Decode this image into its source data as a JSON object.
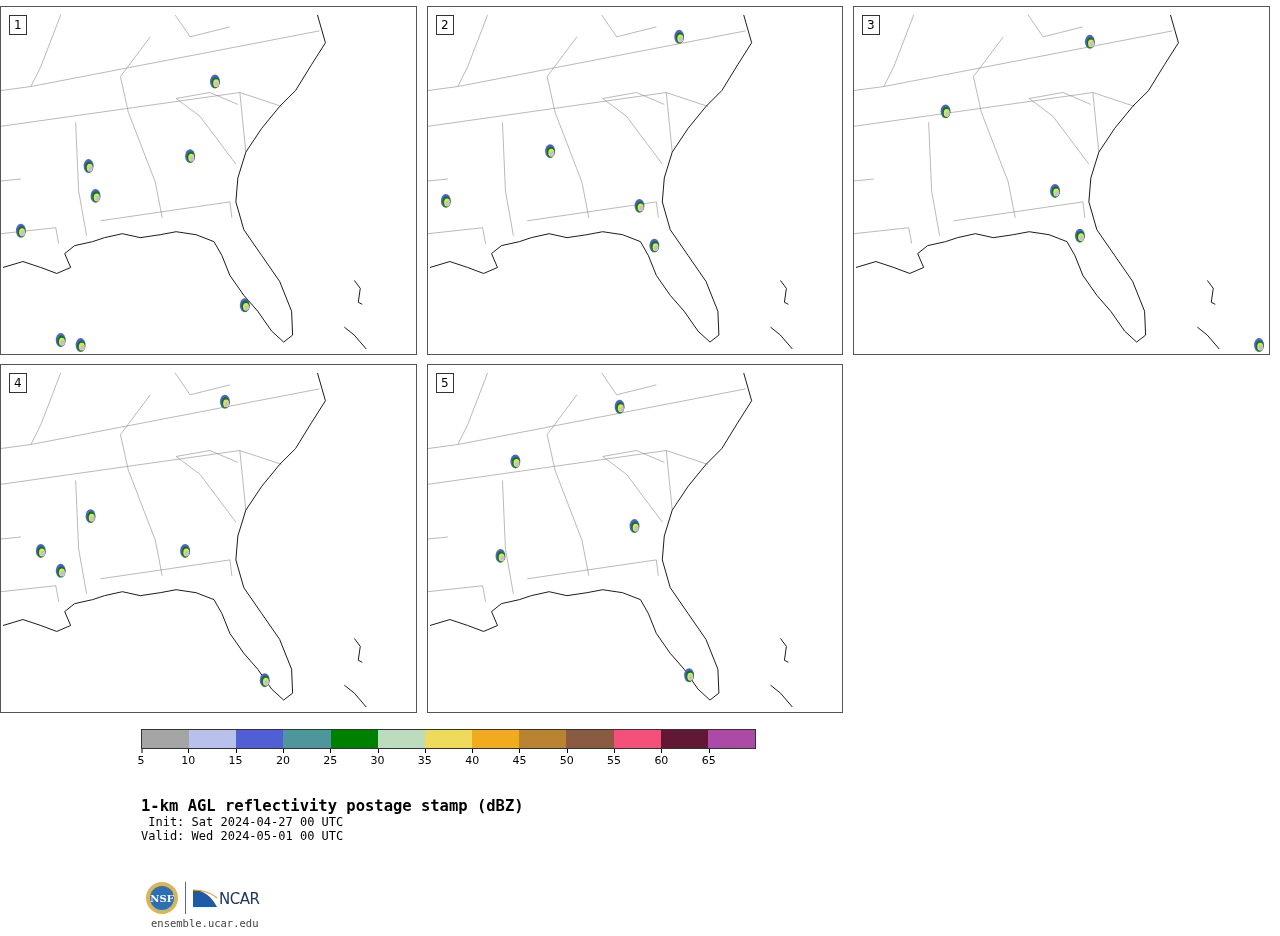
{
  "panels": [
    {
      "label": "1"
    },
    {
      "label": "2"
    },
    {
      "label": "3"
    },
    {
      "label": "4"
    },
    {
      "label": "5"
    }
  ],
  "colorbar": {
    "bins": [
      {
        "color": "#a5a5a5"
      },
      {
        "color": "#b7c1ec"
      },
      {
        "color": "#5060d4"
      },
      {
        "color": "#4e969b"
      },
      {
        "color": "#008000"
      },
      {
        "color": "#bddcbd"
      },
      {
        "color": "#f0da5c"
      },
      {
        "color": "#f0ac1c"
      },
      {
        "color": "#b98332"
      },
      {
        "color": "#8b5a40"
      },
      {
        "color": "#f5507a"
      },
      {
        "color": "#621834"
      },
      {
        "color": "#ac4aa8"
      }
    ],
    "ticks": [
      "5",
      "10",
      "15",
      "20",
      "25",
      "30",
      "35",
      "40",
      "45",
      "50",
      "55",
      "60",
      "65"
    ]
  },
  "title": "1-km AGL reflectivity postage stamp (dBZ)",
  "init": " Init: Sat 2024-04-27 00 UTC",
  "valid": "Valid: Wed 2024-05-01 00 UTC",
  "logo": {
    "nsf_text": "NSF",
    "ncar_text": "NCAR"
  },
  "url": "ensemble.ucar.edu"
}
